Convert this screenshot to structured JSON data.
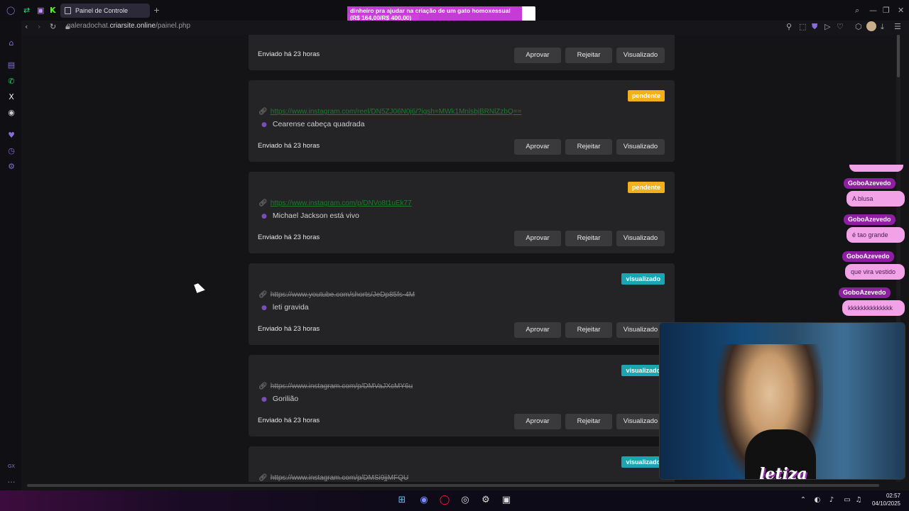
{
  "browser": {
    "tab_title": "Painel de Controle",
    "url_prefix": "galeradochat.",
    "url_domain": "criarsite.online",
    "url_path": "/painel.php"
  },
  "popup": {
    "title": "dinheiro pra ajudar na criação de um gato homoxessual",
    "amount": "(R$ 164,00/R$ 400,00)",
    "progress": 0.41
  },
  "buttons": {
    "approve": "Aprovar",
    "reject": "Rejeitar",
    "viewed": "Visualizado"
  },
  "cards": [
    {
      "sent": "Enviado há 23 horas"
    },
    {
      "status": "pendente",
      "link": "https://www.instagram.com/reel/DN5ZJ06N0j6/?igsh=MWk1MnlsbjBRNlZzbQ==",
      "desc": "Cearense cabeça quadrada",
      "sent": "Enviado há 23 horas"
    },
    {
      "status": "pendente",
      "link": "https://www.instagram.com/p/DNVo8t1uEk77",
      "desc": "Michael Jackson está vivo",
      "sent": "Enviado há 23 horas"
    },
    {
      "status": "visualizado",
      "link": "https://www.youtube.com/shorts/JeDp85fs-4M",
      "desc": "leti gravida",
      "sent": "Enviado há 23 horas"
    },
    {
      "status": "visualizado",
      "link": "https://www.instagram.com/p/DMVaJXcMY6u",
      "desc": "Gorilião",
      "sent": "Enviado há 23 horas"
    },
    {
      "status": "visualizado",
      "link": "https://www.instagram.com/p/DMSi9jjMFQU"
    }
  ],
  "chat": [
    {
      "user": "GoboAzevedo",
      "msg": "A blusa"
    },
    {
      "user": "GoboAzevedo",
      "msg": "é tao grande"
    },
    {
      "user": "GoboAzevedo",
      "msg": "que vira vestido"
    },
    {
      "user": "GoboAzevedo",
      "msg": "kkkkkkkkkkkkkk"
    }
  ],
  "overlay": {
    "logo": "letiza"
  },
  "clock": {
    "time": "02:57",
    "date": "04/10/2025"
  },
  "colors": {
    "pending": "#f2b01c",
    "viewed": "#1ba5b3",
    "chat_name": "#8e1fa0",
    "chat_bubble": "#f2a3e8"
  }
}
